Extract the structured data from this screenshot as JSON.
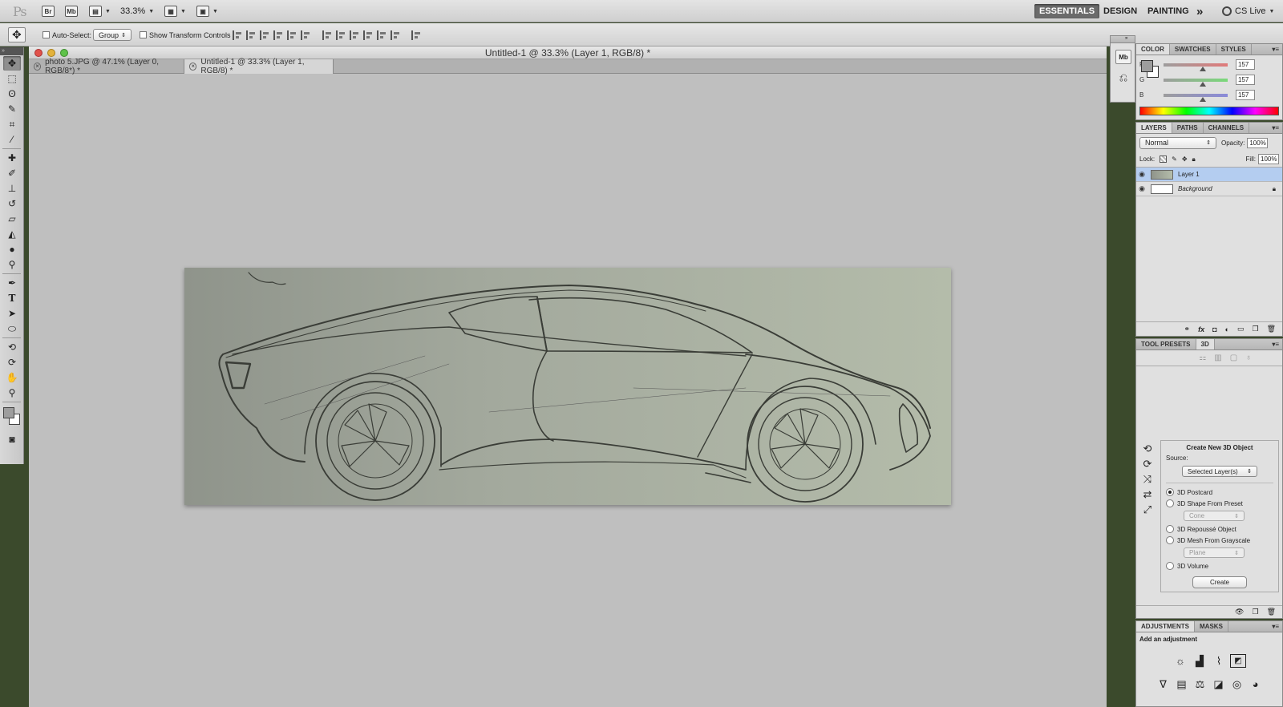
{
  "app": {
    "logo": "Ps",
    "bridge": "Br",
    "minibridge": "Mb",
    "zoom": "33.3%",
    "workspaces": [
      "ESSENTIALS",
      "DESIGN",
      "PAINTING"
    ],
    "more": "»",
    "cslive": "CS Live"
  },
  "options": {
    "auto_select_label": "Auto-Select:",
    "auto_select_value": "Group",
    "show_transform_label": "Show Transform Controls"
  },
  "document": {
    "window_title": "Untitled-1 @ 33.3% (Layer 1, RGB/8) *",
    "tabs": [
      {
        "label": "photo 5.JPG @ 47.1% (Layer 0, RGB/8*) *"
      },
      {
        "label": "Untitled-1 @ 33.3% (Layer 1, RGB/8) *"
      }
    ]
  },
  "color_panel": {
    "tabs": [
      "COLOR",
      "SWATCHES",
      "STYLES"
    ],
    "channels": [
      {
        "label": "R",
        "value": "157",
        "level": 0.616
      },
      {
        "label": "G",
        "value": "157",
        "level": 0.616
      },
      {
        "label": "B",
        "value": "157",
        "level": 0.616
      }
    ],
    "colors": {
      "r_track": "#e07a7a",
      "g_track": "#7ad97a",
      "b_track": "#8a8ad9",
      "fg": "#9d9d9d"
    }
  },
  "layers_panel": {
    "tabs": [
      "LAYERS",
      "PATHS",
      "CHANNELS"
    ],
    "blend_mode": "Normal",
    "opacity_label": "Opacity:",
    "opacity": "100%",
    "lock_label": "Lock:",
    "fill_label": "Fill:",
    "fill": "100%",
    "layers": [
      {
        "name": "Layer 1",
        "selected": true
      },
      {
        "name": "Background",
        "selected": false,
        "locked": true
      }
    ],
    "selected_color": "#b4cdf0"
  },
  "tool_presets_panel": {
    "tabs": [
      "TOOL PRESETS",
      "3D"
    ],
    "create_title": "Create New 3D Object",
    "source_label": "Source:",
    "source_value": "Selected Layer(s)",
    "options": [
      {
        "label": "3D Postcard",
        "checked": true
      },
      {
        "label": "3D Shape From Preset",
        "checked": false
      },
      {
        "label": "3D Repoussé Object",
        "checked": false
      },
      {
        "label": "3D Mesh From Grayscale",
        "checked": false
      },
      {
        "label": "3D Volume",
        "checked": false
      }
    ],
    "shape_preset": "Cone",
    "mesh_preset": "Plane",
    "create_button": "Create"
  },
  "adjustments_panel": {
    "tabs": [
      "ADJUSTMENTS",
      "MASKS"
    ],
    "heading": "Add an adjustment"
  }
}
